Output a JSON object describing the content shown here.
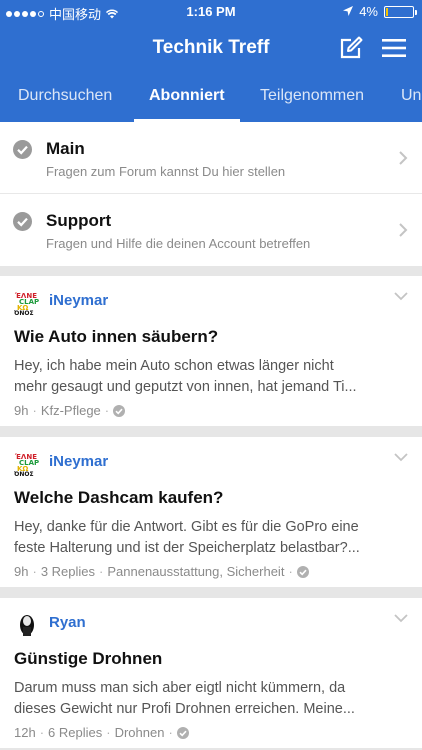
{
  "status_bar": {
    "carrier": "中国移动",
    "time": "1:16 PM",
    "battery_text": "4%",
    "battery_level": 0.04,
    "signal_bars_filled": 4,
    "signal_bars_total": 5
  },
  "header": {
    "title": "Technik Treff",
    "compose_icon": "compose-icon",
    "menu_icon": "hamburger-menu-icon"
  },
  "tabs": [
    {
      "label": "Durchsuchen",
      "active": false
    },
    {
      "label": "Abonniert",
      "active": true
    },
    {
      "label": "Teilgenommen",
      "active": false
    },
    {
      "label": "Un",
      "active": false
    }
  ],
  "forums": [
    {
      "name": "Main",
      "description": "Fragen zum Forum kannst Du hier stellen"
    },
    {
      "name": "Support",
      "description": "Fragen und Hilfe die deinen Account betreffen"
    }
  ],
  "posts": [
    {
      "author": "iNeymar",
      "title": "Wie Auto innen säubern?",
      "excerpt_line1": "Hey, ich habe mein Auto schon etwas länger nicht",
      "excerpt_line2": "mehr gesaugt und geputzt von innen, hat jemand Ti...",
      "time": "9h",
      "replies": "",
      "tags": "Kfz-Pflege"
    },
    {
      "author": "iNeymar",
      "title": "Welche Dashcam kaufen?",
      "excerpt_line1": "Hey, danke für die Antwort. Gibt es für die GoPro eine",
      "excerpt_line2": "feste Halterung und ist der Speicherplatz belastbar?...",
      "time": "9h",
      "replies": "3 Replies",
      "tags": "Pannenausstattung, Sicherheit"
    },
    {
      "author": "Ryan",
      "title": "Günstige Drohnen",
      "excerpt_line1": "Darum muss man sich aber eigtl nicht kümmern, da",
      "excerpt_line2": "dieses Gewicht nur Profi Drohnen erreichen. Meine...",
      "time": "12h",
      "replies": "6 Replies",
      "tags": "Drohnen"
    }
  ],
  "colors": {
    "brand": "#2f6fd0",
    "author": "#2f6fd0",
    "separator": "#e6e6e6"
  }
}
